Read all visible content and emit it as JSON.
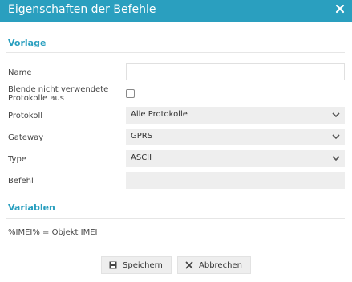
{
  "dialog": {
    "title": "Eigenschaften der Befehle",
    "close_icon": "close-icon"
  },
  "sections": {
    "vorlage": "Vorlage",
    "variablen": "Variablen"
  },
  "form": {
    "name_label": "Name",
    "name_value": "",
    "hide_label_line1": "Blende nicht verwendete",
    "hide_label_line2": "Protokolle aus",
    "hide_checked": false,
    "protokoll_label": "Protokoll",
    "protokoll_value": "Alle Protokolle",
    "gateway_label": "Gateway",
    "gateway_value": "GPRS",
    "type_label": "Type",
    "type_value": "ASCII",
    "befehl_label": "Befehl",
    "befehl_value": ""
  },
  "variables": {
    "text": "%IMEI% = Objekt IMEI"
  },
  "buttons": {
    "save_label": "Speichern",
    "save_icon": "floppy-disk-icon",
    "cancel_label": "Abbrechen",
    "cancel_icon": "close-icon"
  },
  "colors": {
    "accent": "#2a9fbf",
    "field_bg": "#eeeeee"
  }
}
